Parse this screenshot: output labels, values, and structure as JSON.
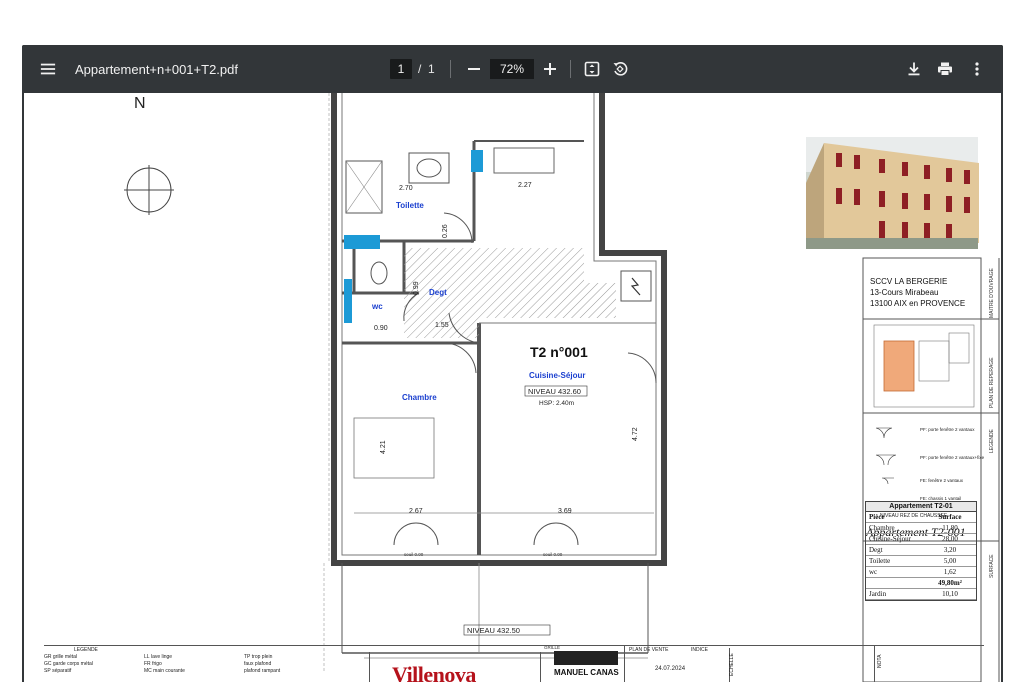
{
  "viewer": {
    "file_name": "Appartement+n+001+T2.pdf",
    "current_page": "1",
    "page_separator": "/",
    "total_pages": "1",
    "zoom": "72%",
    "icons": {
      "menu": "menu-icon",
      "zoom_out": "minus-icon",
      "zoom_in": "plus-icon",
      "fit": "fit-page-icon",
      "rotate": "rotate-icon",
      "download": "download-icon",
      "print": "print-icon",
      "more": "more-vert-icon"
    },
    "colors": {
      "toolbar": "#323639",
      "field": "#191b1c",
      "text": "#f1f1f1"
    }
  },
  "plan": {
    "north": "N",
    "title": "T2 n°001",
    "rooms": {
      "toilette": "Toilette",
      "wc": "wc",
      "degt": "Degt",
      "chambre": "Chambre",
      "cuisine": "Cuisine-Séjour"
    },
    "niveau": "NIVEAU 432.60",
    "hsp": "HSP: 2.40m",
    "niveau_jardin": "NIVEAU 432.50",
    "grille": "GRILLE",
    "seuil_left": "seuil 0.00",
    "seuil_right": "seuil 0.00",
    "dims": {
      "d270": "2.70",
      "d227": "2.27",
      "d026": "0.26",
      "d099": "0.99",
      "d090": "0.90",
      "d155": "1.55",
      "d421": "4.21",
      "d472": "4.72",
      "d267": "2.67",
      "d369": "3.69"
    },
    "wall_color": "#444444",
    "fixture_color": "#1c9ad6",
    "label_color": "#1a3fcf"
  },
  "titleblock": {
    "client": [
      "SCCV LA BERGERIE",
      "13-Cours Mirabeau",
      "13100 AIX en PROVENCE"
    ],
    "side_labels": [
      "MAITRE D'OUVRAGE",
      "PLAN DE REPERAGE",
      "LEGENDE",
      "SURFACE"
    ],
    "legend_items": [
      "PF: porte fenêtre 2 vantaux",
      "PF: porte fenêtre 2 vantaux+fixe",
      "FE: fenêtre 2 vantaux",
      "FE: chassis 1 vantail"
    ],
    "niveau_label": "NIVEAU REZ DE CHAUSSEE",
    "apartment_name": "Appartement T2-001",
    "surface_table": {
      "title": "Appartement T2-01",
      "headers": [
        "Pièce",
        "Surface"
      ],
      "rows": [
        [
          "Chambre",
          "11,80"
        ],
        [
          "Cuisine-Séjour",
          "28,00"
        ],
        [
          "Degt",
          "3,20"
        ],
        [
          "Toilette",
          "5,00"
        ],
        [
          "wc",
          "1,62"
        ]
      ],
      "total": "49,80m²",
      "garden": [
        "Jardin",
        "10,10"
      ]
    }
  },
  "bottom": {
    "legende": "LEGENDE",
    "codes": [
      [
        "GR",
        "grille métal"
      ],
      [
        "GC",
        "garde corps métal"
      ],
      [
        "SP",
        "séparatif"
      ],
      [
        "LL",
        "lave linge"
      ],
      [
        "FR",
        "frigo"
      ],
      [
        "MC",
        "main courante"
      ],
      [
        "TP",
        "trop plein"
      ],
      [
        "",
        "faux plafond"
      ],
      [
        "",
        "plafond rampant"
      ]
    ],
    "brand1": "Villenova",
    "brand2": "MANUEL CANAS",
    "plan_de_vente": "PLAN DE VENTE",
    "indice": "INDICE",
    "date": "24.07.2024",
    "echelle": "ECHELLE",
    "note": "NOTA"
  }
}
